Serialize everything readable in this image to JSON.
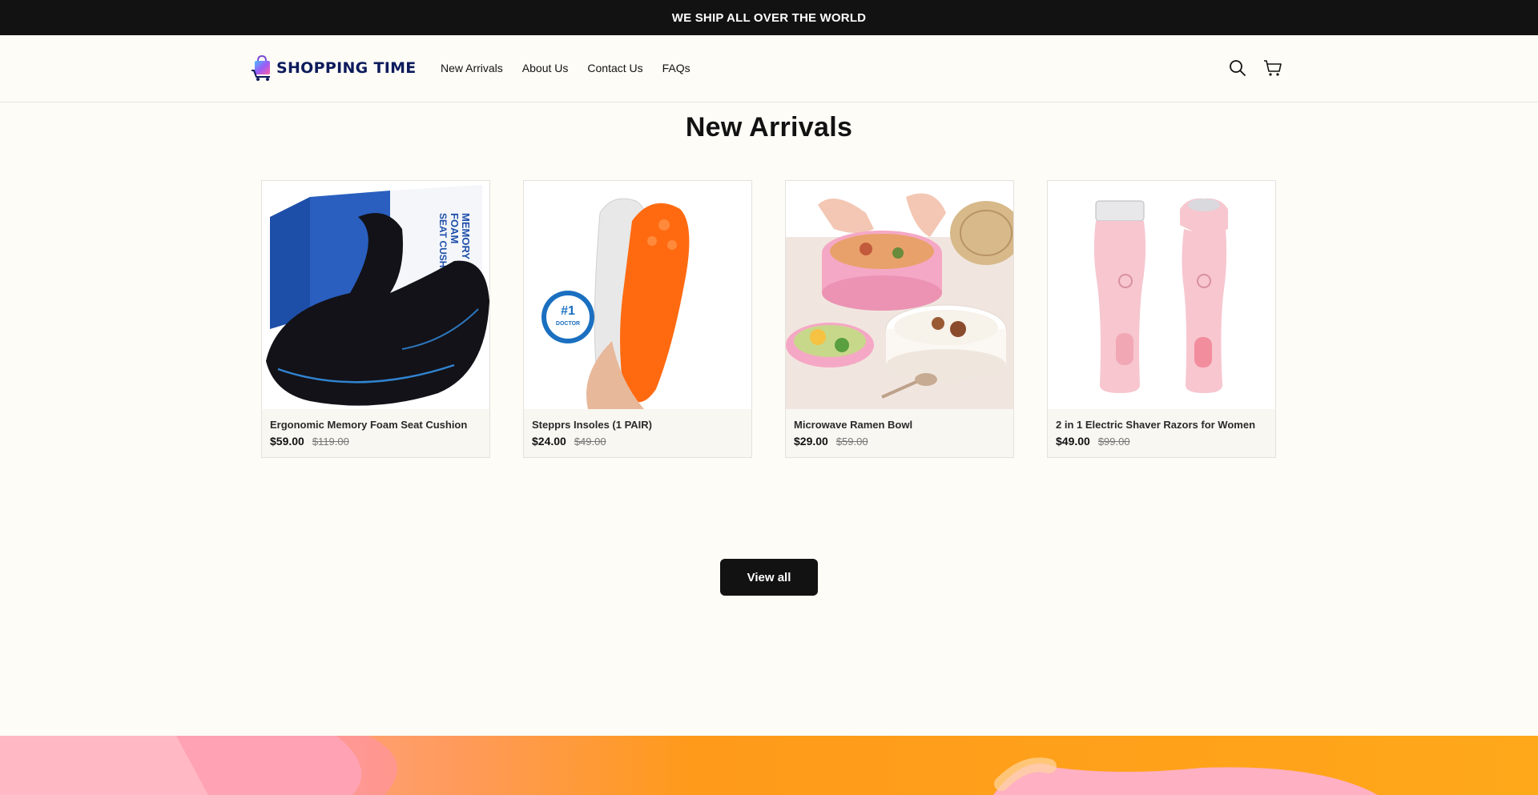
{
  "announcement": {
    "text": "WE SHIP ALL OVER THE WORLD"
  },
  "brand": {
    "name": "SHOPPING TIME"
  },
  "nav": {
    "items": [
      "New Arrivals",
      "About Us",
      "Contact Us",
      "FAQs"
    ]
  },
  "header_icons": [
    "search-icon",
    "cart-icon"
  ],
  "section": {
    "title": "New Arrivals",
    "view_all_label": "View all"
  },
  "products": [
    {
      "title": "Ergonomic Memory Foam Seat Cushion",
      "price": "$59.00",
      "compare_price": "$119.00"
    },
    {
      "title": "Stepprs Insoles (1 PAIR)",
      "price": "$24.00",
      "compare_price": "$49.00"
    },
    {
      "title": "Microwave Ramen Bowl",
      "price": "$29.00",
      "compare_price": "$59.00"
    },
    {
      "title": "2 in 1 Electric Shaver Razors for Women",
      "price": "$49.00",
      "compare_price": "$99.00"
    }
  ],
  "colors": {
    "announcement_bg": "#121212",
    "page_bg": "#fdfcf6",
    "button_bg": "#121212",
    "brand_text": "#0d1b5c"
  }
}
